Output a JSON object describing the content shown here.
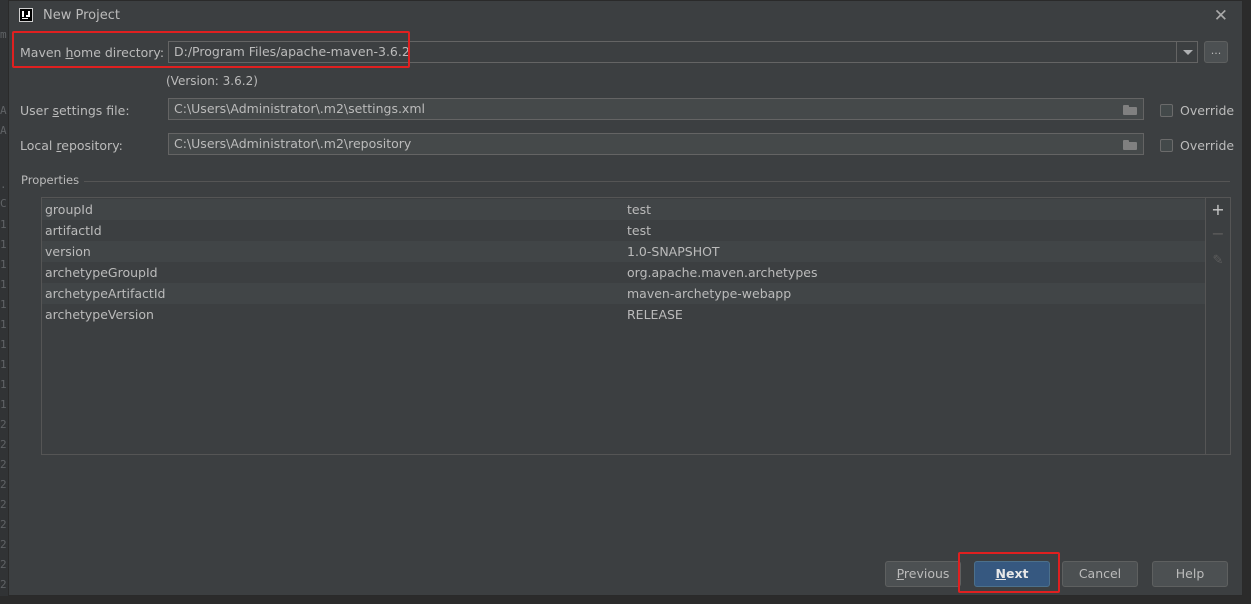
{
  "window": {
    "title": "New Project"
  },
  "maven_home": {
    "label_pre": "Maven ",
    "label_mnemonic": "h",
    "label_post": "ome directory:",
    "value": "D:/Program Files/apache-maven-3.6.2",
    "version_text": "(Version: 3.6.2)",
    "browse_label": "..."
  },
  "user_settings": {
    "label_pre": "User ",
    "label_mnemonic": "s",
    "label_post": "ettings file:",
    "value": "C:\\Users\\Administrator\\.m2\\settings.xml",
    "override_label": "Override",
    "override_checked": false
  },
  "local_repo": {
    "label_pre": "Local ",
    "label_mnemonic": "r",
    "label_post": "epository:",
    "value": "C:\\Users\\Administrator\\.m2\\repository",
    "override_label": "Override",
    "override_checked": false
  },
  "properties": {
    "title": "Properties",
    "rows": [
      {
        "key": "groupId",
        "value": "test"
      },
      {
        "key": "artifactId",
        "value": "test"
      },
      {
        "key": "version",
        "value": "1.0-SNAPSHOT"
      },
      {
        "key": "archetypeGroupId",
        "value": "org.apache.maven.archetypes"
      },
      {
        "key": "archetypeArtifactId",
        "value": "maven-archetype-webapp"
      },
      {
        "key": "archetypeVersion",
        "value": "RELEASE"
      }
    ]
  },
  "buttons": {
    "previous_mnemonic": "P",
    "previous_rest": "revious",
    "next_mnemonic": "N",
    "next_rest": "ext",
    "cancel": "Cancel",
    "help": "Help"
  },
  "colors": {
    "highlight": "#e02020",
    "primary_button": "#365880"
  }
}
